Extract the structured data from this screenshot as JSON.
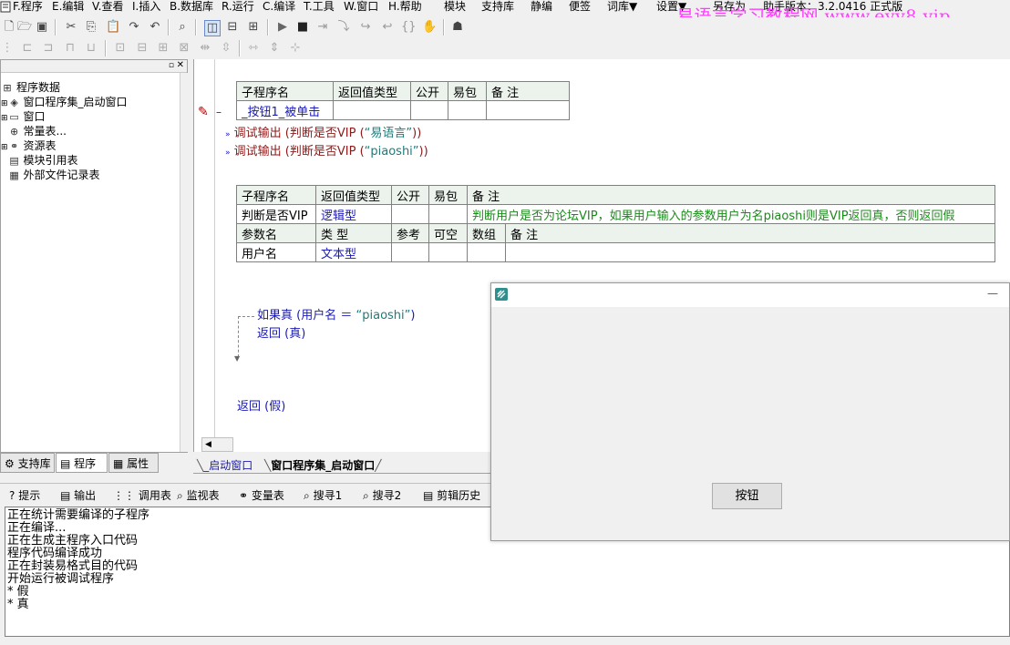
{
  "menu": [
    {
      "label": "F.程序"
    },
    {
      "label": "E.编辑"
    },
    {
      "label": "V.查看"
    },
    {
      "label": "I.插入"
    },
    {
      "label": "B.数据库"
    },
    {
      "label": "R.运行"
    },
    {
      "label": "C.编译"
    },
    {
      "label": "T.工具"
    },
    {
      "label": "W.窗口"
    },
    {
      "label": "H.帮助"
    },
    {
      "label": "模块"
    },
    {
      "label": "支持库"
    },
    {
      "label": "静编"
    },
    {
      "label": "便签"
    },
    {
      "label": "词库▼"
    },
    {
      "label": "设置▼"
    },
    {
      "label": "另存为"
    },
    {
      "label": "助手版本：3.2.0416 正式版"
    }
  ],
  "watermark": "易语言学习教程网 www.eyy8.vip",
  "tree": {
    "root": "程序数据",
    "items": [
      {
        "label": "窗口程序集_启动窗口",
        "icon": "module-icon"
      },
      {
        "label": "窗口",
        "icon": "window-icon"
      },
      {
        "label": "常量表...",
        "icon": "constant-icon"
      },
      {
        "label": "资源表",
        "icon": "resource-icon"
      },
      {
        "label": "模块引用表",
        "icon": "module-ref-icon"
      },
      {
        "label": "外部文件记录表",
        "icon": "file-record-icon"
      }
    ]
  },
  "left_tabs": [
    "支持库",
    "程序",
    "属性"
  ],
  "sub1": {
    "headers": [
      "子程序名",
      "返回值类型",
      "公开",
      "易包",
      "备 注"
    ],
    "row": [
      "_按钮1_被单击",
      "",
      "",
      "",
      ""
    ]
  },
  "code1": [
    {
      "func": "调试输出",
      "rest": " (判断是否VIP (",
      "str": "“易语言”",
      "close": "))"
    },
    {
      "func": "调试输出",
      "rest": " (判断是否VIP (",
      "str": "“piaoshi”",
      "close": "))"
    }
  ],
  "sub2": {
    "headers": [
      "子程序名",
      "返回值类型",
      "公开",
      "易包",
      "备 注"
    ],
    "row": [
      "判断是否VIP",
      "逻辑型",
      "",
      "",
      "判断用户是否为论坛VIP，如果用户输入的参数用户为名piaoshi则是VIP返回真，否则返回假"
    ],
    "param_headers": [
      "参数名",
      "类 型",
      "参考",
      "可空",
      "数组",
      "备 注"
    ],
    "param_row": [
      "用户名",
      "文本型",
      "",
      "",
      "",
      ""
    ]
  },
  "code2": {
    "if_kw": "如果真",
    "if_cond_open": " (用户名 ＝ ",
    "if_str": "“piaoshi”",
    "if_close": ")",
    "ret_true_kw": "返回",
    "ret_true_arg": " (真)",
    "ret_false_kw": "返回",
    "ret_false_arg": " (假)"
  },
  "editor_tabs": [
    "_启动窗口",
    "窗口程序集_启动窗口"
  ],
  "output_tabs": [
    "提示",
    "输出",
    "调用表",
    "监视表",
    "变量表",
    "搜寻1",
    "搜寻2",
    "剪辑历史"
  ],
  "output_lines": [
    "正在统计需要编译的子程序",
    "正在编译...",
    "正在生成主程序入口代码",
    "程序代码编译成功",
    "正在封装易格式目的代码",
    "开始运行被调试程序",
    "* 假",
    "* 真"
  ],
  "runwin": {
    "minimize": "—",
    "button_label": "按钮"
  },
  "colors": {
    "accent": "#1a1ab4",
    "keyword": "#8b1a1a",
    "string": "#1f7a7a",
    "comment": "#1a8a1a",
    "watermark": "#ff3cff"
  }
}
